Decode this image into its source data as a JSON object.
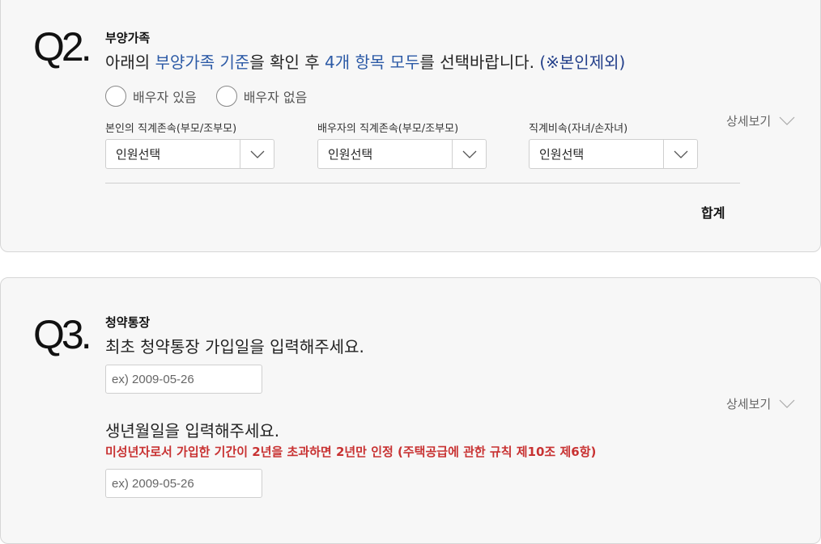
{
  "q2": {
    "number": "Q2.",
    "title": "부양가족",
    "desc": {
      "p1": "아래의 ",
      "link1": "부양가족 기준",
      "p2": "을 확인 후 ",
      "link2": "4개 항목 모두",
      "p3": "를 선택바랍니다. ",
      "note": "(※본인제외)"
    },
    "radios": [
      {
        "label": "배우자 있음",
        "checked": false
      },
      {
        "label": "배우자 없음",
        "checked": false
      }
    ],
    "selects": [
      {
        "label": "본인의 직계존속(부모/조부모)",
        "value": "인원선택"
      },
      {
        "label": "배우자의 직계존속(부모/조부모)",
        "value": "인원선택"
      },
      {
        "label": "직계비속(자녀/손자녀)",
        "value": "인원선택"
      }
    ],
    "detail_label": "상세보기",
    "total_label": "합계"
  },
  "q3": {
    "number": "Q3.",
    "title": "청약통장",
    "desc1": "최초 청약통장 가입일을 입력해주세요.",
    "input1_placeholder": "ex) 2009-05-26",
    "detail_label": "상세보기",
    "desc2": "생년월일을 입력해주세요.",
    "warning": "미성년자로서 가입한 기간이 2년을 초과하면 2년만 인정 (주택공급에 관한 규칙 제10조 제6항)",
    "input2_placeholder": "ex) 2009-05-26"
  },
  "colors": {
    "accent_blue": "#2c5aa6",
    "warning_red": "#c83232",
    "card_bg": "#f7f7f7"
  }
}
